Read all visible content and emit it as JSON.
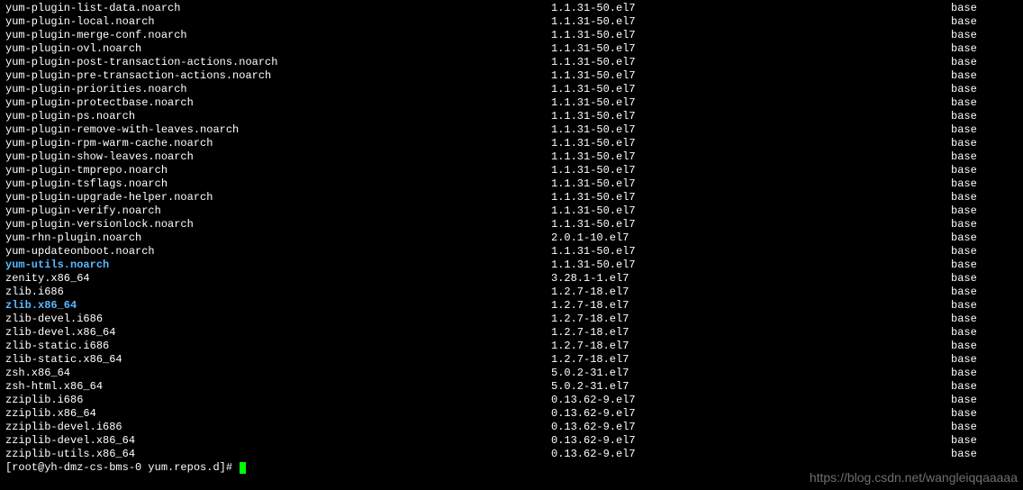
{
  "packages": [
    {
      "name": "yum-plugin-list-data.noarch",
      "version": "1.1.31-50.el7",
      "repo": "base",
      "hl": false
    },
    {
      "name": "yum-plugin-local.noarch",
      "version": "1.1.31-50.el7",
      "repo": "base",
      "hl": false
    },
    {
      "name": "yum-plugin-merge-conf.noarch",
      "version": "1.1.31-50.el7",
      "repo": "base",
      "hl": false
    },
    {
      "name": "yum-plugin-ovl.noarch",
      "version": "1.1.31-50.el7",
      "repo": "base",
      "hl": false
    },
    {
      "name": "yum-plugin-post-transaction-actions.noarch",
      "version": "1.1.31-50.el7",
      "repo": "base",
      "hl": false
    },
    {
      "name": "yum-plugin-pre-transaction-actions.noarch",
      "version": "1.1.31-50.el7",
      "repo": "base",
      "hl": false
    },
    {
      "name": "yum-plugin-priorities.noarch",
      "version": "1.1.31-50.el7",
      "repo": "base",
      "hl": false
    },
    {
      "name": "yum-plugin-protectbase.noarch",
      "version": "1.1.31-50.el7",
      "repo": "base",
      "hl": false
    },
    {
      "name": "yum-plugin-ps.noarch",
      "version": "1.1.31-50.el7",
      "repo": "base",
      "hl": false
    },
    {
      "name": "yum-plugin-remove-with-leaves.noarch",
      "version": "1.1.31-50.el7",
      "repo": "base",
      "hl": false
    },
    {
      "name": "yum-plugin-rpm-warm-cache.noarch",
      "version": "1.1.31-50.el7",
      "repo": "base",
      "hl": false
    },
    {
      "name": "yum-plugin-show-leaves.noarch",
      "version": "1.1.31-50.el7",
      "repo": "base",
      "hl": false
    },
    {
      "name": "yum-plugin-tmprepo.noarch",
      "version": "1.1.31-50.el7",
      "repo": "base",
      "hl": false
    },
    {
      "name": "yum-plugin-tsflags.noarch",
      "version": "1.1.31-50.el7",
      "repo": "base",
      "hl": false
    },
    {
      "name": "yum-plugin-upgrade-helper.noarch",
      "version": "1.1.31-50.el7",
      "repo": "base",
      "hl": false
    },
    {
      "name": "yum-plugin-verify.noarch",
      "version": "1.1.31-50.el7",
      "repo": "base",
      "hl": false
    },
    {
      "name": "yum-plugin-versionlock.noarch",
      "version": "1.1.31-50.el7",
      "repo": "base",
      "hl": false
    },
    {
      "name": "yum-rhn-plugin.noarch",
      "version": "2.0.1-10.el7",
      "repo": "base",
      "hl": false
    },
    {
      "name": "yum-updateonboot.noarch",
      "version": "1.1.31-50.el7",
      "repo": "base",
      "hl": false
    },
    {
      "name": "yum-utils.noarch",
      "version": "1.1.31-50.el7",
      "repo": "base",
      "hl": true
    },
    {
      "name": "zenity.x86_64",
      "version": "3.28.1-1.el7",
      "repo": "base",
      "hl": false
    },
    {
      "name": "zlib.i686",
      "version": "1.2.7-18.el7",
      "repo": "base",
      "hl": false
    },
    {
      "name": "zlib.x86_64",
      "version": "1.2.7-18.el7",
      "repo": "base",
      "hl": true
    },
    {
      "name": "zlib-devel.i686",
      "version": "1.2.7-18.el7",
      "repo": "base",
      "hl": false
    },
    {
      "name": "zlib-devel.x86_64",
      "version": "1.2.7-18.el7",
      "repo": "base",
      "hl": false
    },
    {
      "name": "zlib-static.i686",
      "version": "1.2.7-18.el7",
      "repo": "base",
      "hl": false
    },
    {
      "name": "zlib-static.x86_64",
      "version": "1.2.7-18.el7",
      "repo": "base",
      "hl": false
    },
    {
      "name": "zsh.x86_64",
      "version": "5.0.2-31.el7",
      "repo": "base",
      "hl": false
    },
    {
      "name": "zsh-html.x86_64",
      "version": "5.0.2-31.el7",
      "repo": "base",
      "hl": false
    },
    {
      "name": "zziplib.i686",
      "version": "0.13.62-9.el7",
      "repo": "base",
      "hl": false
    },
    {
      "name": "zziplib.x86_64",
      "version": "0.13.62-9.el7",
      "repo": "base",
      "hl": false
    },
    {
      "name": "zziplib-devel.i686",
      "version": "0.13.62-9.el7",
      "repo": "base",
      "hl": false
    },
    {
      "name": "zziplib-devel.x86_64",
      "version": "0.13.62-9.el7",
      "repo": "base",
      "hl": false
    },
    {
      "name": "zziplib-utils.x86_64",
      "version": "0.13.62-9.el7",
      "repo": "base",
      "hl": false
    }
  ],
  "prompt": "[root@yh-dmz-cs-bms-0 yum.repos.d]# ",
  "watermark": "https://blog.csdn.net/wangleiqqaaaaa"
}
